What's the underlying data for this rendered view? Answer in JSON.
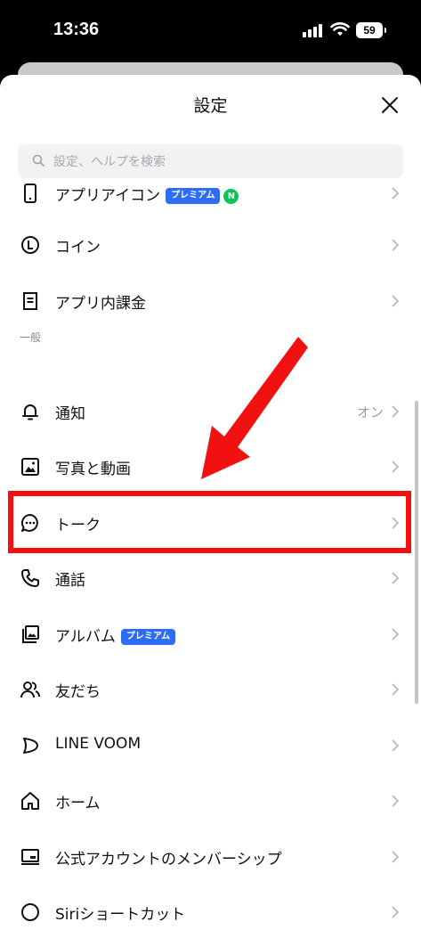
{
  "status_bar": {
    "time": "13:36",
    "battery": "59"
  },
  "sheet": {
    "title": "設定"
  },
  "search": {
    "placeholder": "設定、ヘルプを検索"
  },
  "rows_top": [
    {
      "label": "アプリアイコン",
      "badge": "プレミアム",
      "extra_badge": "N",
      "icon": "phone-icon"
    },
    {
      "label": "コイン",
      "icon": "coin-icon"
    },
    {
      "label": "アプリ内課金",
      "icon": "receipt-icon"
    }
  ],
  "section_general": "一般",
  "rows_general": [
    {
      "label": "通知",
      "value": "オン",
      "icon": "bell-icon"
    },
    {
      "label": "写真と動画",
      "icon": "photo-icon"
    },
    {
      "label": "トーク",
      "icon": "chat-bubble-icon"
    },
    {
      "label": "通話",
      "icon": "phone-call-icon"
    },
    {
      "label": "アルバム",
      "badge": "プレミアム",
      "icon": "album-icon"
    },
    {
      "label": "友だち",
      "icon": "friends-icon"
    },
    {
      "label": "LINE VOOM",
      "icon": "voom-icon"
    },
    {
      "label": "ホーム",
      "icon": "home-icon"
    },
    {
      "label": "公式アカウントのメンバーシップ",
      "icon": "membership-icon"
    },
    {
      "label": "Siriショートカット",
      "icon": "siri-icon"
    }
  ],
  "colors": {
    "highlight": "#f21111",
    "badge": "#2d6cf6",
    "n_badge": "#06c755"
  }
}
